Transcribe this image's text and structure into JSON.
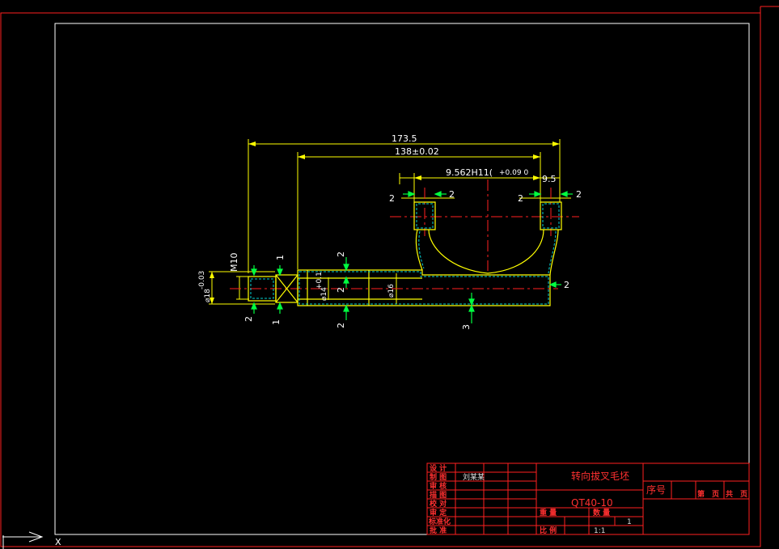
{
  "drawing": {
    "dims": {
      "overall_length": "173.5",
      "center_distance": "138±0.02",
      "fork_width": "9.562H11(",
      "fork_tol": "+0.09 0",
      "slot_width": "9.5",
      "thread": "M10",
      "shaft_dia": "⌀18",
      "shaft_tol": "-0.03",
      "bore_dia": "⌀14",
      "bore_tol": "+0.1",
      "inner_dia": "⌀16",
      "allow_2": "2",
      "allow_1": "1",
      "allow_3": "3"
    }
  },
  "title_block": {
    "rows_left": [
      "设 计",
      "制 图",
      "审 核",
      "描 图",
      "校 对",
      "审 定",
      "标准化",
      "批 准"
    ],
    "designer_name": "刘某某",
    "part_name": "转向拔叉毛坯",
    "material": "QT40-10",
    "weight_label": "重 量",
    "quantity_label": "数 量",
    "quantity_value": "1",
    "scale_label": "比 例",
    "scale_value": "1:1",
    "seq_label": "序号",
    "page_labels": [
      "第",
      "页",
      "共",
      "页"
    ]
  },
  "ucs": {
    "x_label": "X"
  },
  "colors": {
    "background": "#000000",
    "border_red": "#ff2020",
    "frame_white": "#ffffff",
    "part_outline": "#ffff00",
    "hatch": "#00d0d0",
    "allowance": "#00ff40",
    "center_line": "#ff2020"
  }
}
